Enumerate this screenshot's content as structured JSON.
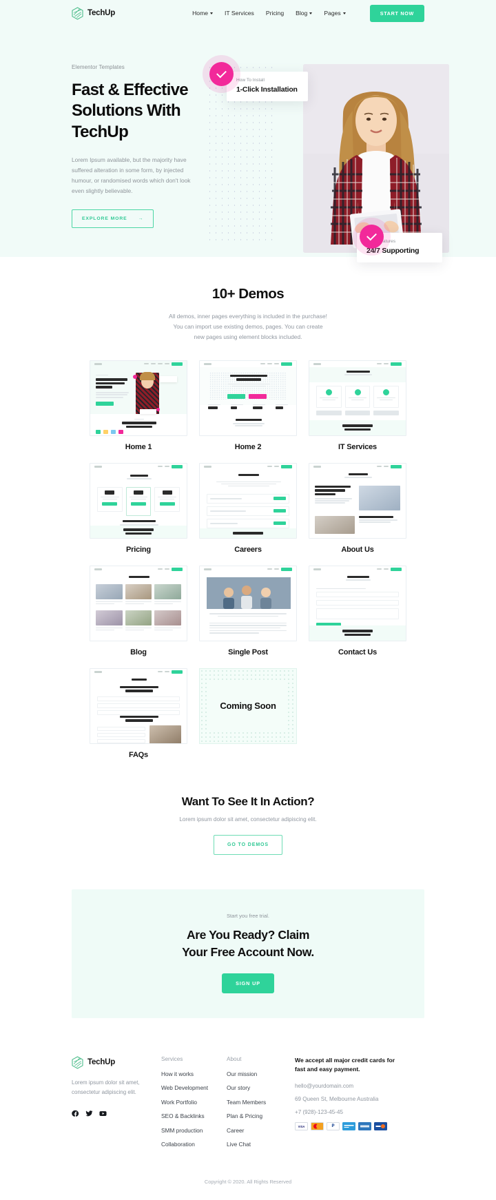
{
  "header": {
    "logo_text": "TechUp",
    "nav": [
      {
        "label": "Home",
        "has_caret": true
      },
      {
        "label": "IT Services",
        "has_caret": false
      },
      {
        "label": "Pricing",
        "has_caret": false
      },
      {
        "label": "Blog",
        "has_caret": true
      },
      {
        "label": "Pages",
        "has_caret": true
      }
    ],
    "cta_label": "START NOW"
  },
  "hero": {
    "eyebrow": "Elementor Templates",
    "title": "Fast & Effective Solutions With TechUp",
    "description": "Lorem Ipsum available, but the majority have suffered alteration in some form, by injected humour, or randomised words which don't look even slightly believable.",
    "button_label": "EXPLORE MORE",
    "button_arrow": "→",
    "card_top": {
      "label": "How To Install",
      "title": "1-Click Installation"
    },
    "card_bottom": {
      "label": "Main Features",
      "title": "24/7 Supporting"
    },
    "accent_color": "#f2299a",
    "brand_color": "#2fd39a"
  },
  "demos": {
    "title": "10+ Demos",
    "description": "All demos, inner pages everything is included in the purchase! You can import use existing demos, pages. You can create new pages using element blocks included.",
    "items": [
      {
        "label": "Home 1",
        "kind": "home1"
      },
      {
        "label": "Home 2",
        "kind": "home2"
      },
      {
        "label": "IT Services",
        "kind": "itservices"
      },
      {
        "label": "Pricing",
        "kind": "pricing"
      },
      {
        "label": "Careers",
        "kind": "careers"
      },
      {
        "label": "About Us",
        "kind": "about"
      },
      {
        "label": "Blog",
        "kind": "blog"
      },
      {
        "label": "Single Post",
        "kind": "singlepost"
      },
      {
        "label": "Contact Us",
        "kind": "contact"
      },
      {
        "label": "FAQs",
        "kind": "faqs"
      }
    ],
    "coming_soon_label": "Coming Soon",
    "thumb_titles": {
      "home1_title": "Fast & Effective Solutions With TechUp",
      "home1_caption": "Digital Agency Providing Business Services",
      "home2_title": "Fast, Secure & Reliable",
      "home2_caption": "Our Services Include",
      "itservices_title": "IT Services",
      "itservices_caption": "Are You Ready? Claim Your Free Account Now",
      "pricing_title": "Pricing",
      "pricing_caption": "30-Day Money-Back Guarantee",
      "pricing_cta": "Are You Ready? Claim Your Free Account Now.",
      "careers_title": "Careers",
      "careers_sub": "Become A Part Of Our Big Family To Inspire And Get Inspired By Professional Experts.",
      "about_title": "About Us",
      "about_sub": "We Excel In Delivering Optimal Solutions.",
      "about_caption": "About Digital Agency Since ~ 1984",
      "blog_title": "Archives",
      "contact_title": "Contact",
      "contact_cta": "Are You Ready? Claim Your Free Account Now.",
      "faqs_title": "FAQs",
      "faqs_sub": "Frequently Asked Questions",
      "faqs_sub2": "Frequently Asked Questions",
      "singlepost_sub": "Lorem ipsum color life book investiture adipiscing Elit"
    },
    "thumb_stats": [
      "1218",
      "96",
      "1,048",
      "865"
    ]
  },
  "action": {
    "title": "Want To See It In Action?",
    "description": "Lorem ipsum dolor sit amet, consectetur adipiscing elit.",
    "button_label": "GO TO DEMOS"
  },
  "cta": {
    "eyebrow": "Start you free trial.",
    "title_line1": "Are You Ready? Claim",
    "title_line2": "Your Free Account Now.",
    "button_label": "SIGN UP",
    "bg_color": "#effbf7"
  },
  "footer": {
    "logo_text": "TechUp",
    "description": "Lorem ipsum dolor sit amet, consectetur adipiscing elit.",
    "socials": [
      "facebook-icon",
      "twitter-icon",
      "youtube-icon"
    ],
    "columns": [
      {
        "heading": "Services",
        "links": [
          "How it works",
          "Web Development",
          "Work Portfolio",
          "SEO & Backlinks",
          "SMM production",
          "Collaboration"
        ]
      },
      {
        "heading": "About",
        "links": [
          "Our mission",
          "Our story",
          "Team Members",
          "Plan & Pricing",
          "Career",
          "Live Chat"
        ]
      }
    ],
    "payment": {
      "title": "We accept all major credit cards for fast and easy payment.",
      "email": "hello@yourdomain.com",
      "address": "69 Queen St, Melbourne Australia",
      "phone": "+7 (928)-123-45-45",
      "cards": [
        {
          "name": "visa",
          "label": "VISA",
          "bg": "#ffffff",
          "fg": "#1a1f71",
          "border": "#d6dbe2"
        },
        {
          "name": "mastercard",
          "label": "",
          "bg": "#eb001b",
          "fg": "#ffffff",
          "border": "#eb001b"
        },
        {
          "name": "paypal",
          "label": "P",
          "bg": "#ffffff",
          "fg": "#003087",
          "border": "#d6dbe2"
        },
        {
          "name": "maestro",
          "label": "",
          "bg": "#2d9cdb",
          "fg": "#ffffff",
          "border": "#2d9cdb"
        },
        {
          "name": "amex",
          "label": "",
          "bg": "#2e77bc",
          "fg": "#ffffff",
          "border": "#2e77bc"
        },
        {
          "name": "discover",
          "label": "",
          "bg": "#1a4fa0",
          "fg": "#ffffff",
          "border": "#1a4fa0"
        }
      ]
    },
    "copyright": "Copyright © 2020.  All Rights Reserved"
  }
}
